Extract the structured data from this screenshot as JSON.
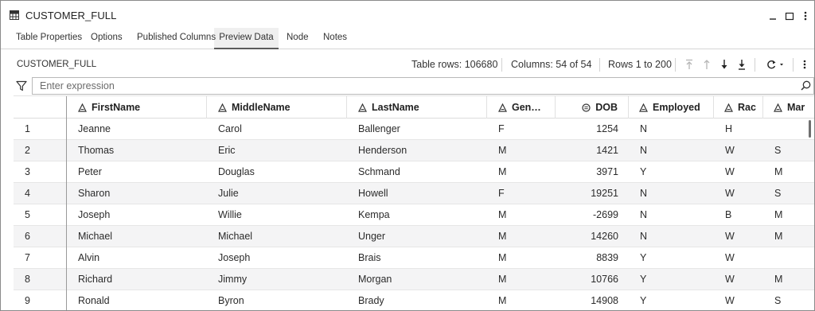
{
  "window": {
    "title": "CUSTOMER_FULL"
  },
  "tabs": [
    {
      "label": "Table Properties",
      "active": false
    },
    {
      "label": "Options",
      "active": false
    },
    {
      "label": "Published Columns",
      "active": false
    },
    {
      "label": "Preview Data",
      "active": true
    },
    {
      "label": "Node",
      "active": false
    },
    {
      "label": "Notes",
      "active": false
    }
  ],
  "toolbar": {
    "table_name": "CUSTOMER_FULL",
    "table_rows": "Table rows: 106680",
    "columns": "Columns: 54 of 54",
    "rows_range": "Rows 1 to 200"
  },
  "filter": {
    "placeholder": "Enter expression"
  },
  "grid": {
    "columns": [
      {
        "label": "FirstName",
        "type": "character"
      },
      {
        "label": "MiddleName",
        "type": "character"
      },
      {
        "label": "LastName",
        "type": "character"
      },
      {
        "label": "Gen…",
        "type": "character"
      },
      {
        "label": "DOB",
        "type": "numeric"
      },
      {
        "label": "Employed",
        "type": "character"
      },
      {
        "label": "Rac",
        "type": "character"
      },
      {
        "label": "Mar",
        "type": "character"
      }
    ],
    "rows": [
      {
        "n": "1",
        "cells": [
          "Jeanne",
          "Carol",
          "Ballenger",
          "F",
          "1254",
          "N",
          "H",
          ""
        ]
      },
      {
        "n": "2",
        "cells": [
          "Thomas",
          "Eric",
          "Henderson",
          "M",
          "1421",
          "N",
          "W",
          "S"
        ]
      },
      {
        "n": "3",
        "cells": [
          "Peter",
          "Douglas",
          "Schmand",
          "M",
          "3971",
          "Y",
          "W",
          "M"
        ]
      },
      {
        "n": "4",
        "cells": [
          "Sharon",
          "Julie",
          "Howell",
          "F",
          "19251",
          "N",
          "W",
          "S"
        ]
      },
      {
        "n": "5",
        "cells": [
          "Joseph",
          "Willie",
          "Kempa",
          "M",
          "-2699",
          "N",
          "B",
          "M"
        ]
      },
      {
        "n": "6",
        "cells": [
          "Michael",
          "Michael",
          "Unger",
          "M",
          "14260",
          "N",
          "W",
          "M"
        ]
      },
      {
        "n": "7",
        "cells": [
          "Alvin",
          "Joseph",
          "Brais",
          "M",
          "8839",
          "Y",
          "W",
          ""
        ]
      },
      {
        "n": "8",
        "cells": [
          "Richard",
          "Jimmy",
          "Morgan",
          "M",
          "10766",
          "Y",
          "W",
          "M"
        ]
      },
      {
        "n": "9",
        "cells": [
          "Ronald",
          "Byron",
          "Brady",
          "M",
          "14908",
          "Y",
          "W",
          "S"
        ]
      }
    ]
  },
  "icons": {
    "window": "table-icon",
    "minimize": "minimize-icon",
    "maximize": "maximize-icon",
    "more": "more-vertical-icon",
    "first": "first-page-icon",
    "previous": "previous-page-icon",
    "next": "next-page-icon",
    "last": "last-page-icon",
    "refresh": "refresh-icon",
    "filter": "filter-icon",
    "search": "search-icon",
    "character_column": "character-type-icon",
    "numeric_column": "numeric-type-icon"
  },
  "colors": {
    "border": "#8a8a8a",
    "alt_row": "#f4f4f5",
    "active_tab_bg": "#efefef",
    "disabled_icon": "#b5b5b5"
  }
}
